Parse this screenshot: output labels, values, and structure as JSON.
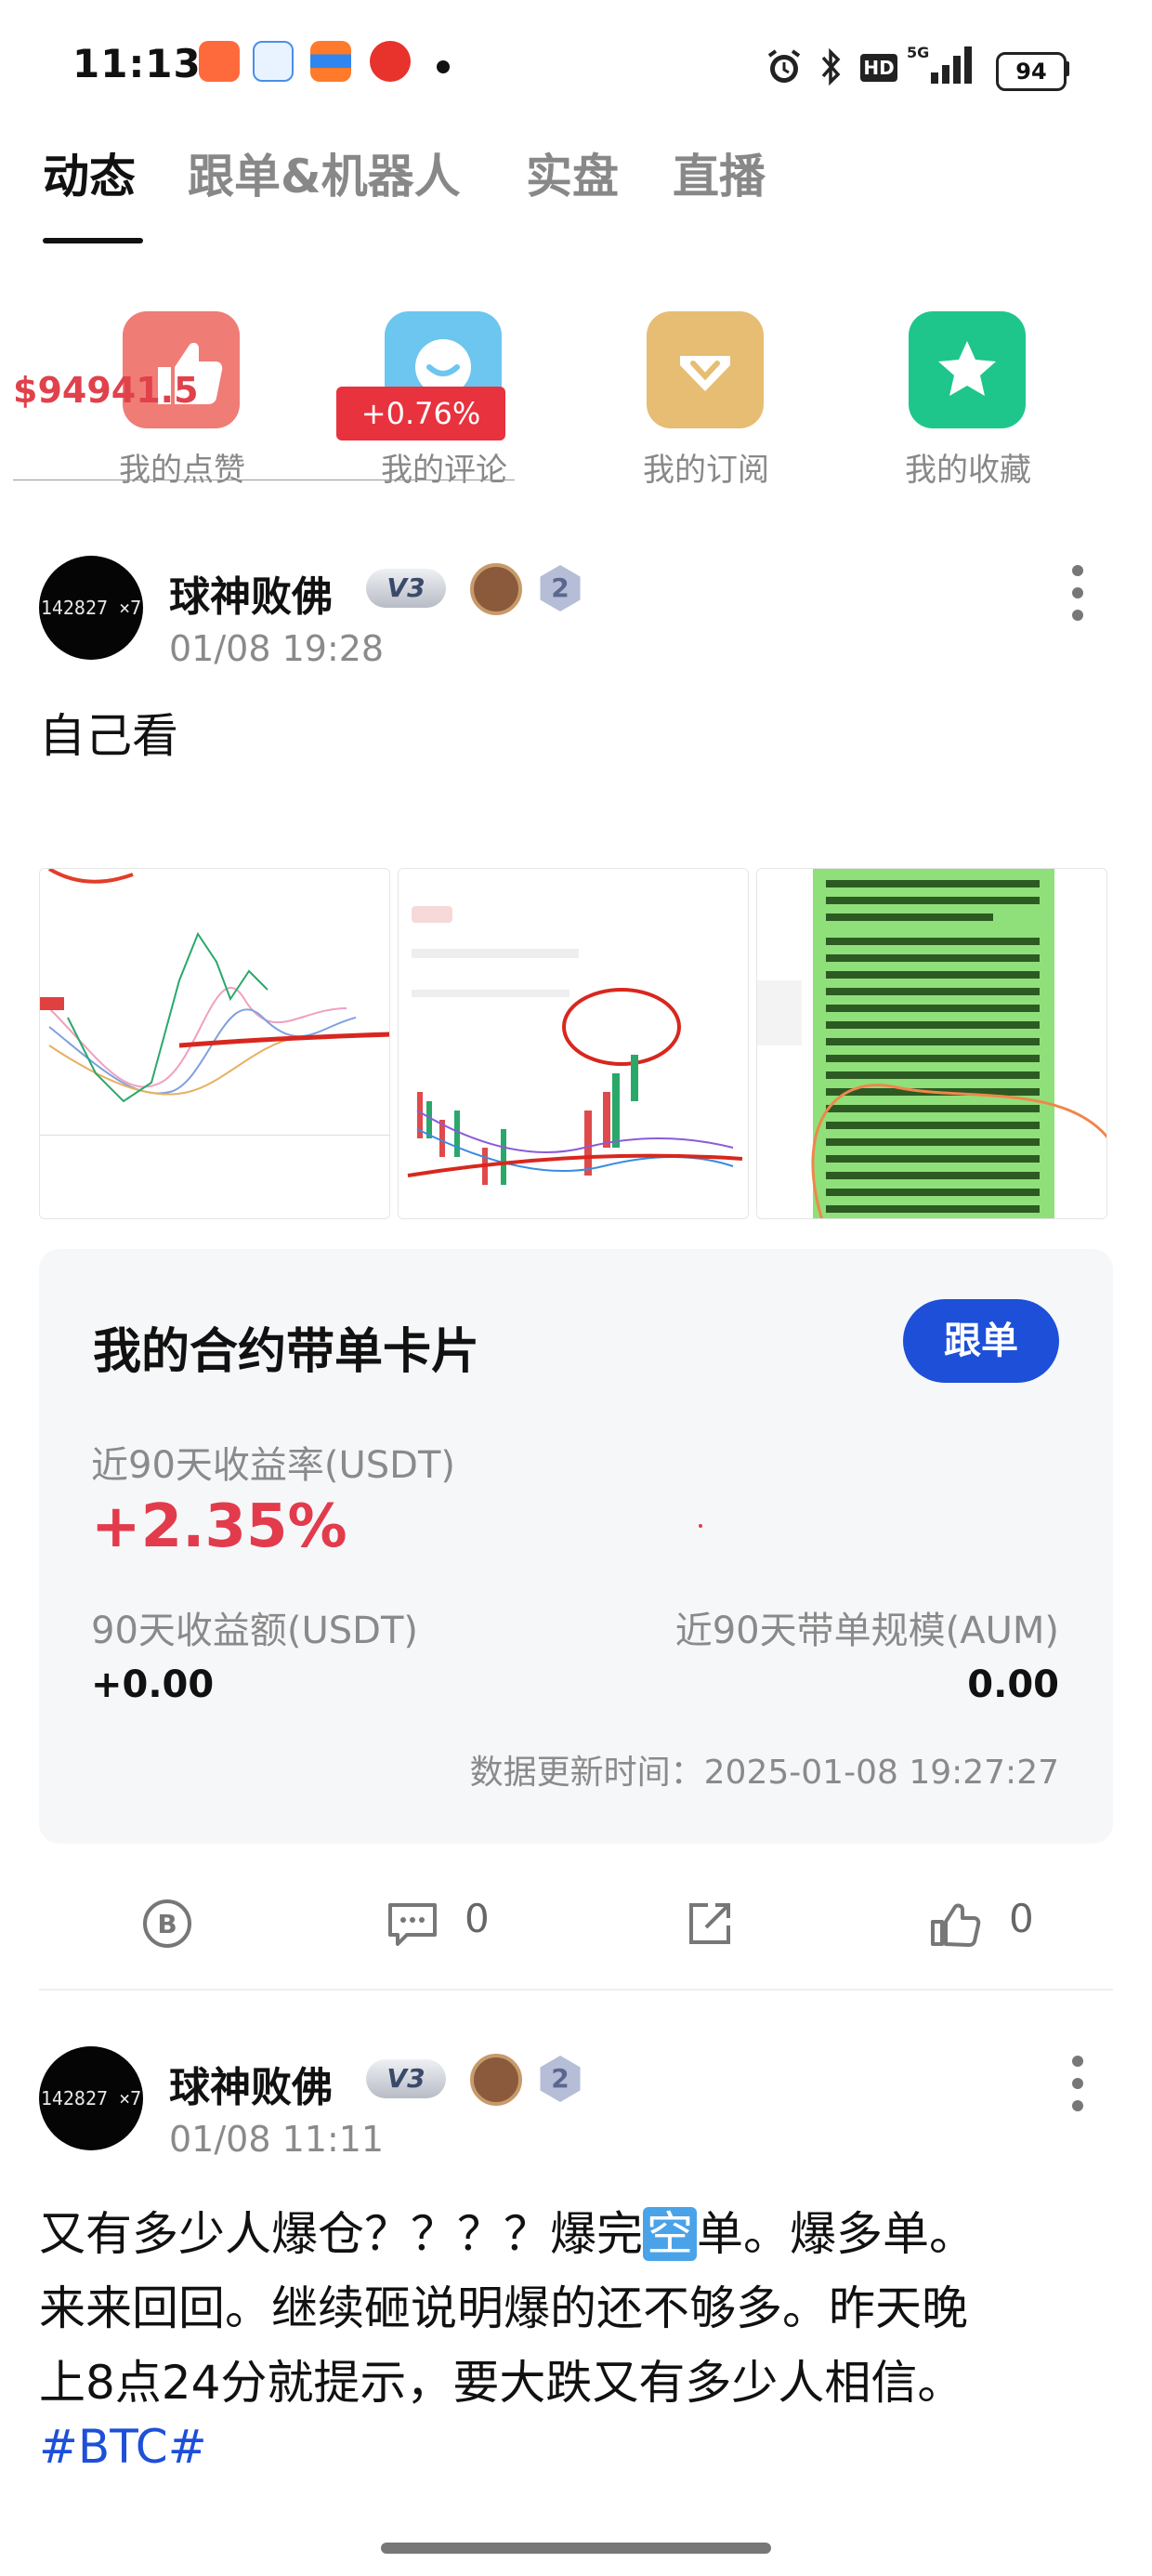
{
  "status_bar": {
    "time": "11:13",
    "battery": "94"
  },
  "tabs": [
    "动态",
    "跟单&机器人",
    "实盘",
    "直播"
  ],
  "quick_actions": [
    {
      "label": "我的点赞",
      "icon": "thumbs-up-icon",
      "color": "#f07c76"
    },
    {
      "label": "我的评论",
      "icon": "comment-smile-icon",
      "color": "#6cc6ef"
    },
    {
      "label": "我的订阅",
      "icon": "subscribe-diamond-icon",
      "color": "#e6bd72"
    },
    {
      "label": "我的收藏",
      "icon": "star-icon",
      "color": "#1ec68c"
    }
  ],
  "overlay": {
    "price": "$94941.5",
    "change": "+0.76%"
  },
  "post1": {
    "avatar_text": "142827 ×7",
    "author": "球神败佛",
    "level": "V3",
    "badge_number": "2",
    "date": "01/08 19:28",
    "text": "自己看",
    "images": [
      "chart-screenshot-1",
      "chart-screenshot-2",
      "text-screenshot-3"
    ]
  },
  "copy_card": {
    "title": "我的合约带单卡片",
    "follow_label": "跟单",
    "return_label": "近90天收益率(USDT)",
    "return_value": "+2.35%",
    "profit_label": "90天收益额(USDT)",
    "profit_value": "+0.00",
    "aum_label": "近90天带单规模(AUM)",
    "aum_value": "0.00",
    "updated": "数据更新时间：2025-01-08 19:27:27"
  },
  "post1_actions": {
    "comments": "0",
    "likes": "0"
  },
  "post2": {
    "avatar_text": "142827 ×7",
    "author": "球神败佛",
    "level": "V3",
    "badge_number": "2",
    "date": "01/08 11:11",
    "line1a": "又有多少人爆仓？？？？爆完",
    "line1b": "空",
    "line1c": "单。爆多单。",
    "line2": "来来回回。继续砸说明爆的还不够多。昨天晚",
    "line3": "上8点24分就提示，要大跌又有多少人相信。",
    "hashtag": "#BTC#"
  }
}
